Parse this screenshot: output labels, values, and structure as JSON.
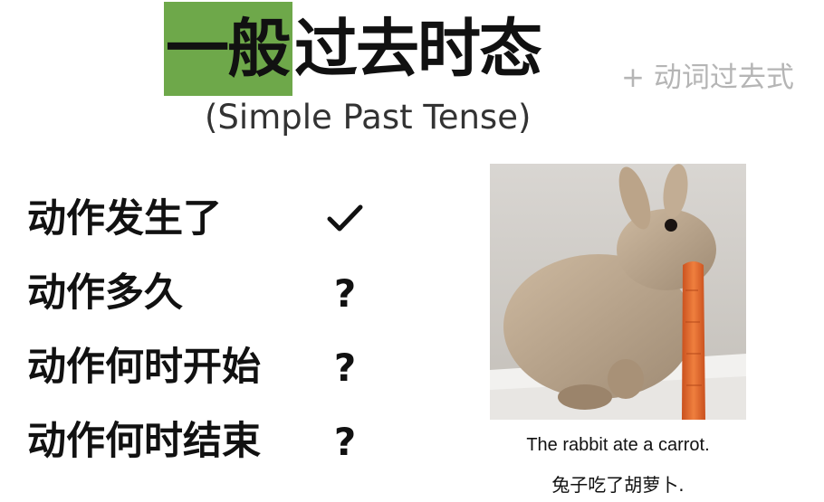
{
  "title": {
    "highlighted": "一般",
    "rest": "过去时态",
    "note": "+ 动词过去式",
    "subtitle": "(Simple Past Tense)",
    "highlight_color": "#6ea84a"
  },
  "rows": [
    {
      "label": "动作发生了",
      "mark": "✓",
      "mark_icon": "check-icon"
    },
    {
      "label": "动作多久",
      "mark": "?",
      "mark_icon": "question-icon"
    },
    {
      "label": "动作何时开始",
      "mark": "?",
      "mark_icon": "question-icon"
    },
    {
      "label": "动作何时结束",
      "mark": "?",
      "mark_icon": "question-icon"
    }
  ],
  "image": {
    "caption_en": "The rabbit ate a carrot.",
    "caption_zh": "兔子吃了胡萝卜."
  }
}
